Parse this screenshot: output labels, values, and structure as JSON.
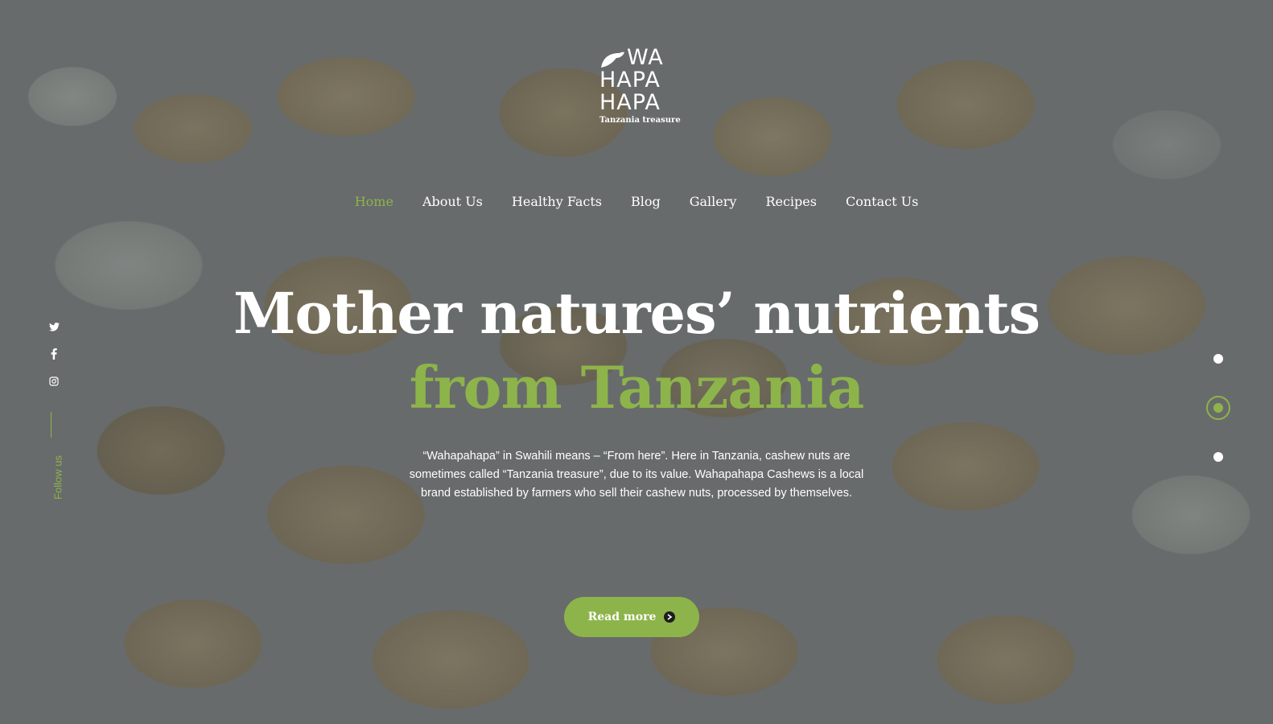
{
  "brand": {
    "logo_line1": "WA",
    "logo_line2": "HAPA",
    "logo_line3": "HAPA",
    "tagline": "Tanzania treasure"
  },
  "nav": {
    "items": [
      {
        "label": "Home",
        "active": true
      },
      {
        "label": "About Us",
        "active": false
      },
      {
        "label": "Healthy Facts",
        "active": false
      },
      {
        "label": "Blog",
        "active": false
      },
      {
        "label": "Gallery",
        "active": false
      },
      {
        "label": "Recipes",
        "active": false
      },
      {
        "label": "Contact Us",
        "active": false
      }
    ]
  },
  "hero": {
    "title_line1": "Mother natures’ nutrients",
    "title_line2": "from Tanzania",
    "body": "“Wahapahapa” in Swahili means – “From here”. Here in Tanzania, cashew nuts are sometimes called “Tanzania treasure”, due to its value. Wahapahapa Cashews is a local brand established by farmers who sell their cashew nuts, processed by themselves.",
    "cta_label": "Read more"
  },
  "social": {
    "icons": [
      "twitter-icon",
      "facebook-icon",
      "instagram-icon"
    ],
    "follow_label": "Follow us"
  },
  "slider": {
    "total": 3,
    "active_index": 2
  },
  "colors": {
    "accent": "#8db44a",
    "text": "#ffffff"
  }
}
